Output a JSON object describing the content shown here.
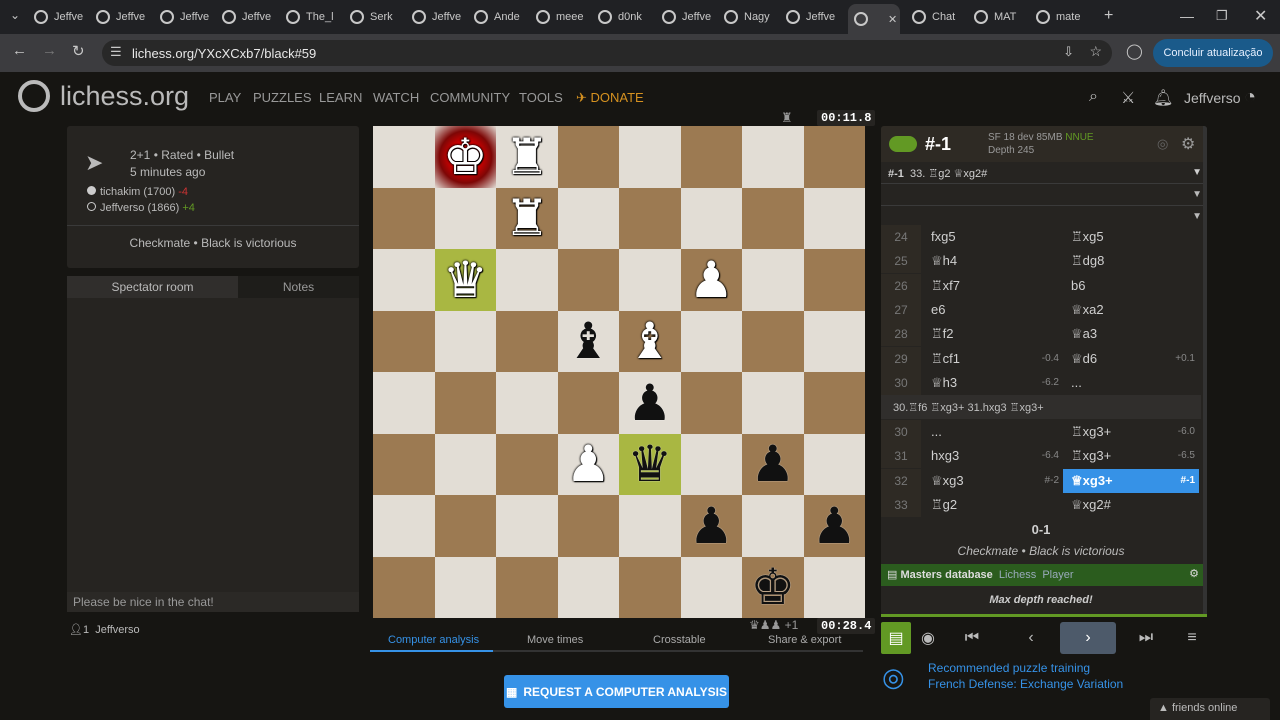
{
  "browser": {
    "tabs": [
      {
        "title": "Jeffve"
      },
      {
        "title": "Jeffve"
      },
      {
        "title": "Jeffve"
      },
      {
        "title": "Jeffve"
      },
      {
        "title": "The_l"
      },
      {
        "title": "Serk"
      },
      {
        "title": "Jeffve"
      },
      {
        "title": "Ande"
      },
      {
        "title": "meee"
      },
      {
        "title": "d0nk"
      },
      {
        "title": "Jeffve"
      },
      {
        "title": "Nagy"
      },
      {
        "title": "Jeffve"
      },
      {
        "title": ""
      },
      {
        "title": "Chat"
      },
      {
        "title": "MAT"
      },
      {
        "title": "mate"
      }
    ],
    "url": "lichess.org/YXcXCxb7/black#59",
    "update_label": "Concluir atualização"
  },
  "header": {
    "logo_text": "lichess.org",
    "nav": [
      "PLAY",
      "PUZZLES",
      "LEARN",
      "WATCH",
      "COMMUNITY",
      "TOOLS"
    ],
    "donate": "DONATE",
    "username": "Jeffverso"
  },
  "game": {
    "type": "2+1 • Rated • Bullet",
    "time_ago": "5 minutes ago",
    "white_player": "tichakim (1700)",
    "white_diff": "-4",
    "black_player": "Jeffverso (1866)",
    "black_diff": "+4",
    "result_text": "Checkmate • Black is victorious"
  },
  "chat": {
    "tab_spectator": "Spectator room",
    "tab_notes": "Notes",
    "placeholder": "Please be nice in the chat!",
    "watchers_count": "1",
    "watcher_name": "Jeffverso"
  },
  "board": {
    "squares": [
      [
        "",
        "wK",
        "wR",
        "",
        "",
        "",
        "",
        ""
      ],
      [
        "",
        "",
        "wR",
        "",
        "",
        "",
        "",
        ""
      ],
      [
        "",
        "wQ",
        "",
        "",
        "",
        "wP",
        "",
        ""
      ],
      [
        "",
        "",
        "",
        "bB",
        "wB",
        "",
        "",
        ""
      ],
      [
        "",
        "",
        "",
        "",
        "bP",
        "",
        "",
        ""
      ],
      [
        "",
        "",
        "",
        "wP",
        "bQ",
        "",
        "bP",
        ""
      ],
      [
        "",
        "",
        "",
        "",
        "",
        "bP",
        "",
        "bP"
      ],
      [
        "",
        "",
        "",
        "",
        "",
        "",
        "bK",
        ""
      ]
    ],
    "ranks": [
      "1",
      "2",
      "3",
      "4",
      "5",
      "6",
      "7",
      "8"
    ],
    "files": [
      "h",
      "g",
      "f",
      "e",
      "d",
      "c",
      "b",
      "a"
    ],
    "top_clock": "00:11.8",
    "bottom_clock": "00:28.4",
    "bottom_material": "+1"
  },
  "under_board_tabs": [
    "Computer analysis",
    "Move times",
    "Crosstable",
    "Share & export"
  ],
  "request_analysis_label": "REQUEST A COMPUTER ANALYSIS",
  "analysis": {
    "eval": "#-1",
    "engine": "SF 18 dev 85MB",
    "nnue": "NNUE",
    "depth": "Depth 245",
    "pv_eval": "#-1",
    "pv_line": "33. ♖g2 ♕xg2#",
    "moves": [
      {
        "n": "24",
        "w": "fxg5",
        "we": "",
        "b": "♖xg5",
        "be": ""
      },
      {
        "n": "25",
        "w": "♕h4",
        "we": "",
        "b": "♖dg8",
        "be": ""
      },
      {
        "n": "26",
        "w": "♖xf7",
        "we": "",
        "b": "b6",
        "be": ""
      },
      {
        "n": "27",
        "w": "e6",
        "we": "",
        "b": "♕xa2",
        "be": ""
      },
      {
        "n": "28",
        "w": "♖f2",
        "we": "",
        "b": "♕a3",
        "be": ""
      },
      {
        "n": "29",
        "w": "♖cf1",
        "we": "-0.4",
        "b": "♕d6",
        "be": "+0.1"
      },
      {
        "n": "30",
        "w": "♕h3",
        "we": "-6.2",
        "b": "...",
        "be": ""
      }
    ],
    "variation": "30.♖f6 ♖xg3+ 31.hxg3 ♖xg3+",
    "moves2": [
      {
        "n": "30",
        "w": "...",
        "we": "",
        "b": "♖xg3+",
        "be": "-6.0"
      },
      {
        "n": "31",
        "w": "hxg3",
        "we": "-6.4",
        "b": "♖xg3+",
        "be": "-6.5"
      },
      {
        "n": "32",
        "w": "♕xg3",
        "we": "#-2",
        "b": "♕xg3+",
        "be": "#-1"
      },
      {
        "n": "33",
        "w": "♖g2",
        "we": "",
        "b": "♕xg2#",
        "be": ""
      }
    ],
    "result": "0-1",
    "result_text": "Checkmate • Black is victorious",
    "explorer_db": "Masters database",
    "explorer_lichess": "Lichess",
    "explorer_player": "Player",
    "max_depth": "Max depth reached!"
  },
  "puzzle": {
    "title": "Recommended puzzle training",
    "subtitle": "French Defense: Exchange Variation"
  },
  "friends_online": "friends online",
  "colors": {
    "accent": "#3692e7",
    "board_light": "#e2ddd5",
    "board_dark": "#9c7a52",
    "highlight": "#a9b742"
  }
}
